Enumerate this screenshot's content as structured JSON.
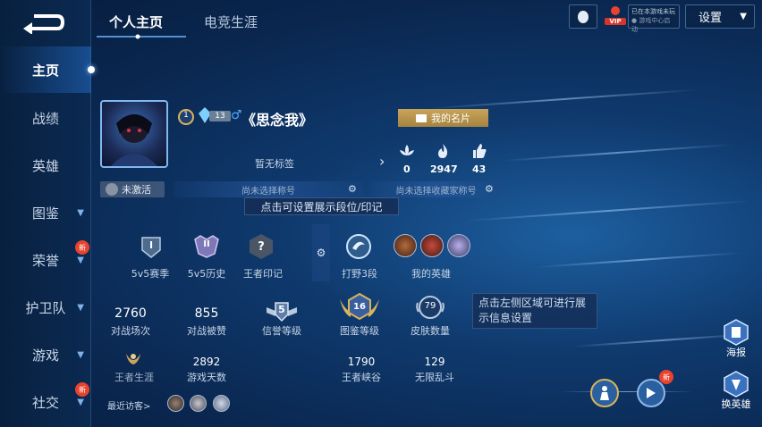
{
  "sidebar": {
    "items": [
      {
        "label": "主页",
        "active": true
      },
      {
        "label": "战绩"
      },
      {
        "label": "英雄"
      },
      {
        "label": "图鉴",
        "has_chevron": true
      },
      {
        "label": "荣誉",
        "has_chevron": true,
        "badge": "新"
      },
      {
        "label": "护卫队",
        "has_chevron": true
      },
      {
        "label": "游戏",
        "has_chevron": true
      },
      {
        "label": "社交",
        "has_chevron": true,
        "badge": "新"
      }
    ]
  },
  "header": {
    "tabs": [
      {
        "label": "个人主页",
        "active": true
      },
      {
        "label": "电竞生涯"
      }
    ],
    "vip_label": "VIP",
    "status_line1": "已在本游戏未玩",
    "status_line2": "● 游戏中心启动",
    "settings_label": "设置"
  },
  "profile": {
    "level": "1",
    "rank_num": "13",
    "gender_icon": "male-icon",
    "name": "《思念我》",
    "card_button": "我的名片",
    "tag": "暂无标签",
    "stats": [
      {
        "icon": "lotus-icon",
        "value": "0"
      },
      {
        "icon": "flame-icon",
        "value": "2947"
      },
      {
        "icon": "thumbs-up-icon",
        "value": "43"
      }
    ],
    "inactive_label": "未激活",
    "title_placeholder": "尚未选择称号",
    "collector_placeholder": "尚未选择收藏家称号",
    "tooltip": "点击可设置展示段位/印记"
  },
  "badges_row": [
    {
      "label": "5v5赛季",
      "glyph": "I"
    },
    {
      "label": "5v5历史",
      "glyph": "II"
    },
    {
      "label": "王者印记",
      "glyph": "?"
    },
    {
      "label": "打野3段"
    },
    {
      "label": "我的英雄"
    }
  ],
  "stats_grid": [
    {
      "value": "2760",
      "label": "对战场次"
    },
    {
      "value": "855",
      "label": "对战被赞"
    },
    {
      "value": "5",
      "label": "信誉等级"
    },
    {
      "value": "16",
      "label": "图鉴等级"
    },
    {
      "value": "79",
      "label": "皮肤数量"
    }
  ],
  "stats_bottom": [
    {
      "label": "王者生涯"
    },
    {
      "value": "2892",
      "label": "游戏天数"
    },
    {
      "value": "1790",
      "label": "王者峡谷"
    },
    {
      "value": "129",
      "label": "无限乱斗"
    }
  ],
  "info_tip": "点击左侧区域可进行展示信息设置",
  "visitors_label": "最近访客>",
  "right_buttons": [
    {
      "label": "海报"
    },
    {
      "label": "换英雄",
      "badge": "新"
    }
  ],
  "colors": {
    "accent_gold": "#c9a45a",
    "badge_red": "#e8432e",
    "bg_dark": "#0a2750"
  }
}
